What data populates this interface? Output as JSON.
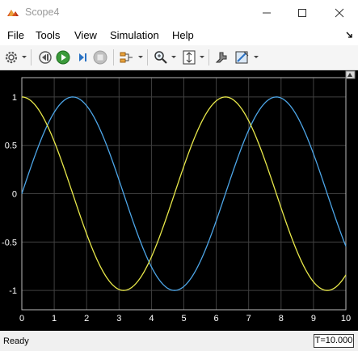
{
  "window": {
    "title": "Scope4",
    "icons": {
      "app": "matlab-scope-icon",
      "minimize": "minimize-icon",
      "maximize": "maximize-icon",
      "close": "close-icon"
    }
  },
  "menubar": {
    "items": [
      {
        "label": "File"
      },
      {
        "label": "Tools"
      },
      {
        "label": "View"
      },
      {
        "label": "Simulation"
      },
      {
        "label": "Help"
      }
    ],
    "dock_icon": "dock-arrow-icon"
  },
  "toolbar": {
    "icons": [
      "settings-gear-icon",
      "step-back-icon",
      "run-icon",
      "step-forward-icon",
      "stop-icon",
      "signal-selector-icon",
      "zoom-icon",
      "autoscale-icon",
      "cursor-measurement-icon",
      "highlight-icon"
    ]
  },
  "status": {
    "text": "Ready",
    "time": "T=10.000"
  },
  "colors": {
    "background": "#000000",
    "grid": "#404040",
    "series1": "#4da6e8",
    "series2": "#e8e84a",
    "tick_text": "#ffffff"
  },
  "chart_data": {
    "type": "line",
    "title": "",
    "xlabel": "",
    "ylabel": "",
    "xlim": [
      0,
      10
    ],
    "ylim": [
      -1.2,
      1.2
    ],
    "xticks": [
      0,
      1,
      2,
      3,
      4,
      5,
      6,
      7,
      8,
      9,
      10
    ],
    "yticks": [
      -1,
      -0.5,
      0,
      0.5,
      1
    ],
    "ytick_labels": [
      "-1",
      "-0.5",
      "0",
      "0.5",
      "1"
    ],
    "grid": true,
    "series": [
      {
        "color": "#4da6e8",
        "function": "sin",
        "x": [
          0,
          0.5,
          1,
          1.5,
          2,
          2.5,
          3,
          3.5,
          4,
          4.5,
          5,
          5.5,
          6,
          6.5,
          7,
          7.5,
          8,
          8.5,
          9,
          9.5,
          10
        ],
        "values": [
          0,
          0.479,
          0.841,
          0.997,
          0.909,
          0.598,
          0.141,
          -0.351,
          -0.757,
          -0.978,
          -0.959,
          -0.706,
          -0.279,
          0.215,
          0.657,
          0.938,
          0.989,
          0.798,
          0.412,
          -0.075,
          -0.544
        ]
      },
      {
        "color": "#e8e84a",
        "function": "cos",
        "x": [
          0,
          0.5,
          1,
          1.5,
          2,
          2.5,
          3,
          3.5,
          4,
          4.5,
          5,
          5.5,
          6,
          6.5,
          7,
          7.5,
          8,
          8.5,
          9,
          9.5,
          10
        ],
        "values": [
          1,
          0.878,
          0.54,
          0.071,
          -0.416,
          -0.801,
          -0.99,
          -0.936,
          -0.654,
          -0.211,
          0.284,
          0.709,
          0.96,
          0.977,
          0.754,
          0.347,
          -0.146,
          -0.602,
          -0.911,
          -0.997,
          -0.839
        ]
      }
    ]
  }
}
